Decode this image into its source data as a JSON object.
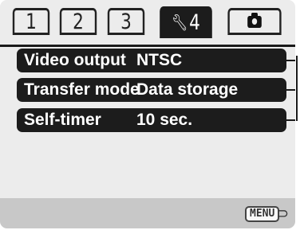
{
  "tabs": [
    {
      "label": "1"
    },
    {
      "label": "2"
    },
    {
      "label": "3"
    },
    {
      "label": "4",
      "icon": "wrench-icon"
    },
    {
      "icon": "camera-icon"
    }
  ],
  "menu_items": [
    {
      "label": "Video output",
      "value": "NTSC"
    },
    {
      "label": "Transfer mode",
      "value": "Data storage"
    },
    {
      "label": "Self-timer",
      "value": "10 sec."
    }
  ],
  "footer": {
    "menu_label": "MENU",
    "return_icon": "return-arrow-icon"
  }
}
